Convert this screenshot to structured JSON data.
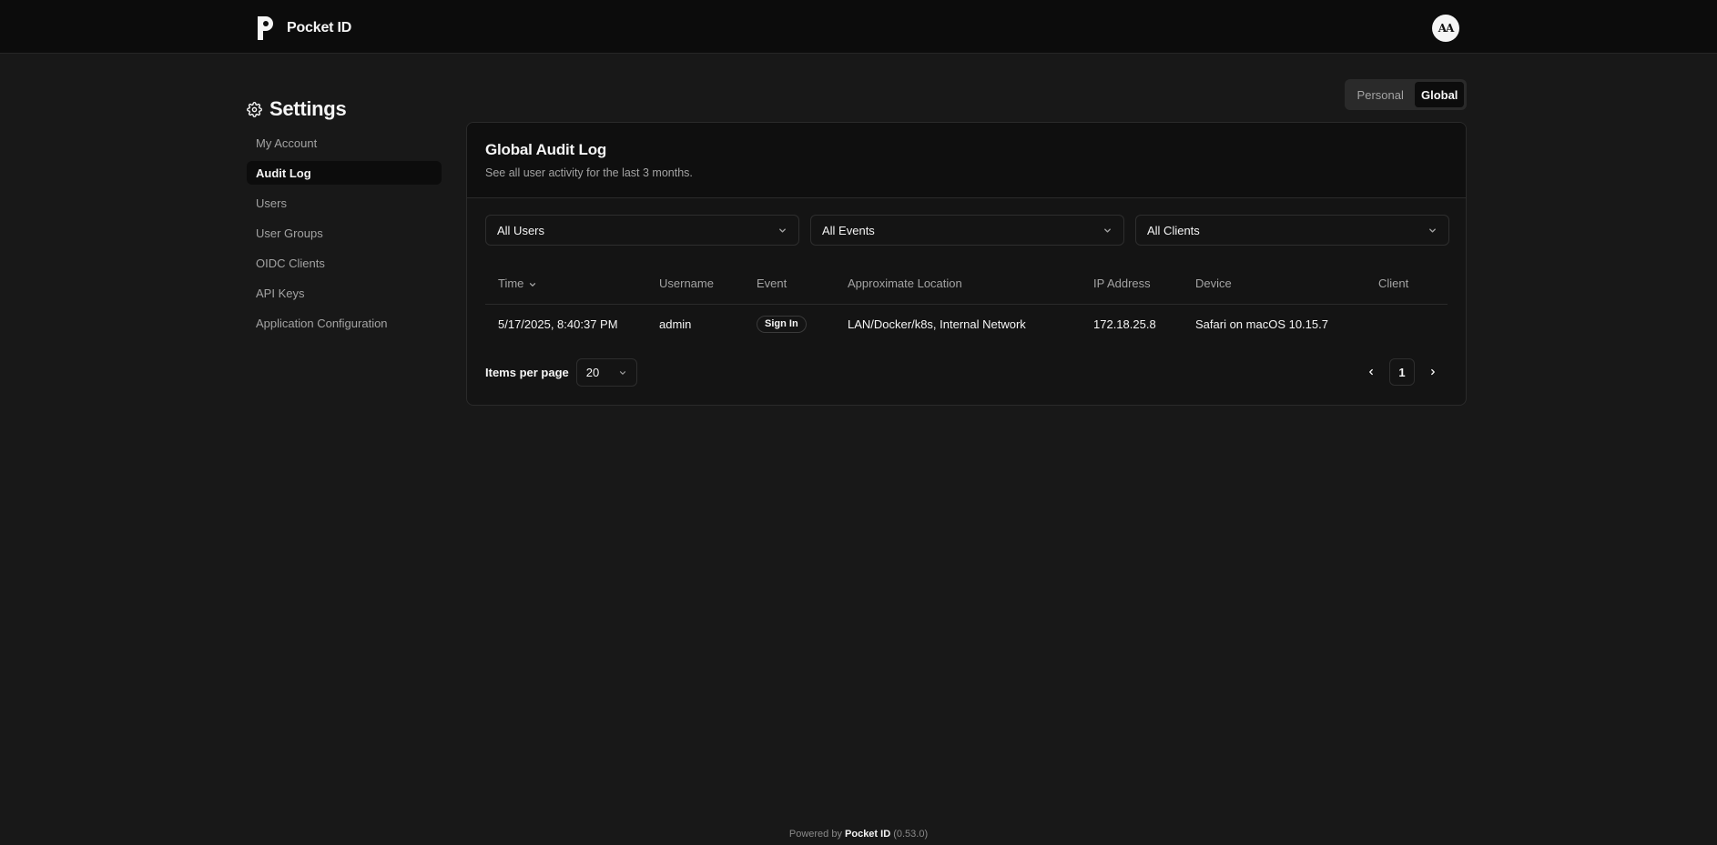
{
  "header": {
    "app_name": "Pocket ID",
    "avatar_initials": "AA"
  },
  "sidebar": {
    "title": "Settings",
    "items": [
      {
        "label": "My Account",
        "active": false
      },
      {
        "label": "Audit Log",
        "active": true
      },
      {
        "label": "Users",
        "active": false
      },
      {
        "label": "User Groups",
        "active": false
      },
      {
        "label": "OIDC Clients",
        "active": false
      },
      {
        "label": "API Keys",
        "active": false
      },
      {
        "label": "Application Configuration",
        "active": false
      }
    ]
  },
  "scope_toggle": {
    "personal_label": "Personal",
    "global_label": "Global",
    "selected": "Global"
  },
  "audit": {
    "title": "Global Audit Log",
    "description": "See all user activity for the last 3 months.",
    "filters": {
      "users": "All Users",
      "events": "All Events",
      "clients": "All Clients"
    },
    "columns": {
      "time": "Time",
      "username": "Username",
      "event": "Event",
      "location": "Approximate Location",
      "ip": "IP Address",
      "device": "Device",
      "client": "Client"
    },
    "rows": [
      {
        "time": "5/17/2025, 8:40:37 PM",
        "username": "admin",
        "event": "Sign In",
        "location": "LAN/Docker/k8s, Internal Network",
        "ip": "172.18.25.8",
        "device": "Safari on macOS 10.15.7",
        "client": ""
      }
    ],
    "items_per_page_label": "Items per page",
    "items_per_page": "20",
    "current_page": "1"
  },
  "footer": {
    "prefix": "Powered by",
    "brand": "Pocket ID",
    "version": "(0.53.0)"
  },
  "colors": {
    "background": "#181818",
    "header_bg": "#0c0c0c",
    "text": "#f5f5f5",
    "muted": "#a3a3a3"
  }
}
